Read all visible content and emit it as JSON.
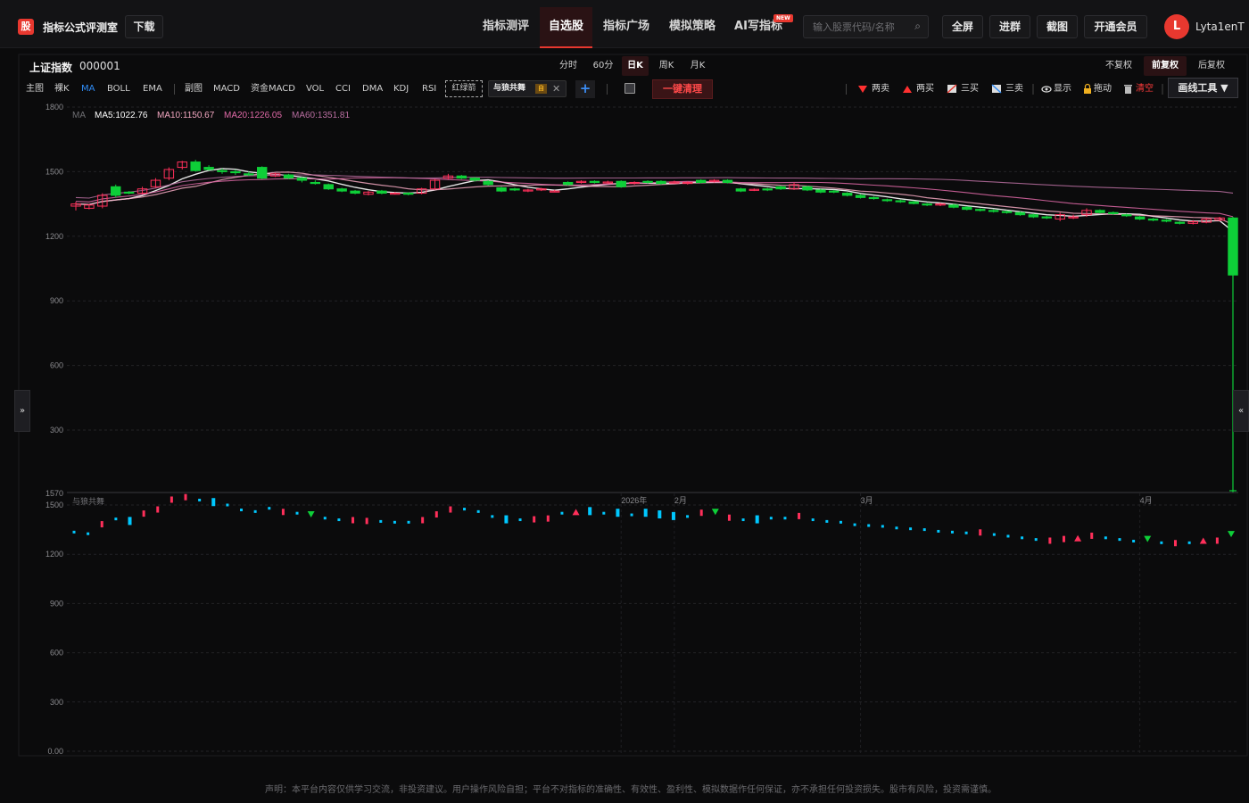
{
  "header": {
    "logo_glyph": "股",
    "app_title": "指标公式评测室",
    "download_label": "下载",
    "nav": [
      {
        "label": "指标测评"
      },
      {
        "label": "自选股"
      },
      {
        "label": "指标广场"
      },
      {
        "label": "模拟策略"
      },
      {
        "label": "AI写指标"
      }
    ],
    "new_badge": "NEW",
    "search_placeholder": "输入股票代码/名称",
    "search_glyph": "⌕",
    "fullscreen_label": "全屏",
    "group_label": "进群",
    "screenshot_label": "截图",
    "vip_label": "开通会员",
    "avatar_letter": "L",
    "username": "Lyta1enT"
  },
  "stock": {
    "name": "上证指数",
    "code": "000001"
  },
  "periods": [
    "分时",
    "60分",
    "日K",
    "周K",
    "月K"
  ],
  "adjust": [
    "不复权",
    "前复权",
    "后复权"
  ],
  "main_indicators": [
    "主图",
    "裸K",
    "MA",
    "BOLL",
    "EMA"
  ],
  "sub_indicators": [
    "副图",
    "MACD",
    "资金MACD",
    "VOL",
    "CCI",
    "DMA",
    "KDJ",
    "RSI"
  ],
  "custom_tag": "红绿箭",
  "chip": {
    "label": "与狼共舞",
    "self": "自",
    "close_glyph": "✕"
  },
  "add_glyph": "+",
  "clear_label": "一键清理",
  "tools": [
    "两卖",
    "两买",
    "三买",
    "三卖",
    "显示",
    "拖动",
    "清空"
  ],
  "draw_tools_label": "画线工具 ▼",
  "side_left": "»",
  "side_right": "«",
  "ma_legend": {
    "label": "MA",
    "ma5": "MA5:1022.76",
    "ma10": "MA10:1150.67",
    "ma20": "MA20:1226.05",
    "ma60": "MA60:1351.81"
  },
  "colors": {
    "up": "#ff2f5a",
    "down": "#0ecf38",
    "ma5": "#ffffff",
    "ma10": "#f2a7c0",
    "ma20": "#e16aa8",
    "ma60": "#b86ea0",
    "accent": "#e8382f",
    "sub_down": "#00c8ff"
  },
  "chart_data": [
    {
      "type": "candlestick",
      "ylim": [
        0,
        1800
      ],
      "yticks": [
        "1800",
        "1500",
        "1200",
        "900",
        "600",
        "300"
      ],
      "lines": [
        "MA5",
        "MA10",
        "MA20",
        "MA60"
      ],
      "grid": true
    },
    {
      "type": "scatter",
      "title": "与狼共舞",
      "ylim": [
        0,
        1570
      ],
      "yticks": [
        "1570",
        "1500",
        "1200",
        "900",
        "600",
        "300",
        "0.00"
      ],
      "xticks": [
        "2026年",
        "2月",
        "3月",
        "4月"
      ],
      "grid": true
    }
  ],
  "candles": [
    [
      1340,
      1350,
      1320,
      1360
    ],
    [
      1330,
      1345,
      1325,
      1350
    ],
    [
      1340,
      1390,
      1330,
      1400
    ],
    [
      1430,
      1390,
      1380,
      1440
    ],
    [
      1405,
      1400,
      1395,
      1410
    ],
    [
      1400,
      1420,
      1395,
      1430
    ],
    [
      1430,
      1460,
      1425,
      1470
    ],
    [
      1470,
      1510,
      1460,
      1520
    ],
    [
      1520,
      1545,
      1510,
      1550
    ],
    [
      1545,
      1505,
      1500,
      1555
    ],
    [
      1520,
      1510,
      1505,
      1530
    ],
    [
      1505,
      1500,
      1490,
      1515
    ],
    [
      1500,
      1495,
      1485,
      1510
    ],
    [
      1490,
      1485,
      1480,
      1500
    ],
    [
      1520,
      1470,
      1465,
      1525
    ],
    [
      1480,
      1490,
      1475,
      1495
    ],
    [
      1485,
      1470,
      1465,
      1490
    ],
    [
      1470,
      1460,
      1450,
      1475
    ],
    [
      1450,
      1445,
      1440,
      1460
    ],
    [
      1440,
      1420,
      1415,
      1445
    ],
    [
      1420,
      1410,
      1405,
      1425
    ],
    [
      1410,
      1400,
      1395,
      1415
    ],
    [
      1395,
      1405,
      1390,
      1410
    ],
    [
      1410,
      1400,
      1395,
      1415
    ],
    [
      1400,
      1400,
      1395,
      1405
    ],
    [
      1400,
      1395,
      1390,
      1405
    ],
    [
      1400,
      1420,
      1395,
      1425
    ],
    [
      1420,
      1460,
      1415,
      1465
    ],
    [
      1470,
      1480,
      1465,
      1490
    ],
    [
      1480,
      1470,
      1465,
      1485
    ],
    [
      1470,
      1460,
      1455,
      1475
    ],
    [
      1455,
      1440,
      1435,
      1460
    ],
    [
      1425,
      1410,
      1405,
      1430
    ],
    [
      1420,
      1415,
      1410,
      1425
    ],
    [
      1410,
      1415,
      1405,
      1420
    ],
    [
      1415,
      1420,
      1410,
      1425
    ],
    [
      1410,
      1410,
      1405,
      1415
    ],
    [
      1450,
      1440,
      1435,
      1455
    ],
    [
      1450,
      1455,
      1445,
      1460
    ],
    [
      1455,
      1450,
      1445,
      1460
    ],
    [
      1450,
      1452,
      1445,
      1458
    ],
    [
      1455,
      1430,
      1425,
      1460
    ],
    [
      1445,
      1450,
      1440,
      1455
    ],
    [
      1455,
      1450,
      1445,
      1460
    ],
    [
      1455,
      1445,
      1440,
      1460
    ],
    [
      1450,
      1452,
      1445,
      1458
    ],
    [
      1445,
      1450,
      1440,
      1455
    ],
    [
      1460,
      1450,
      1445,
      1465
    ],
    [
      1455,
      1460,
      1450,
      1465
    ],
    [
      1460,
      1450,
      1445,
      1465
    ],
    [
      1420,
      1410,
      1405,
      1425
    ],
    [
      1415,
      1418,
      1410,
      1422
    ],
    [
      1420,
      1415,
      1410,
      1425
    ],
    [
      1430,
      1420,
      1415,
      1435
    ],
    [
      1420,
      1440,
      1415,
      1450
    ],
    [
      1430,
      1415,
      1410,
      1435
    ],
    [
      1415,
      1405,
      1400,
      1420
    ],
    [
      1410,
      1405,
      1400,
      1415
    ],
    [
      1400,
      1390,
      1385,
      1405
    ],
    [
      1390,
      1380,
      1375,
      1395
    ],
    [
      1380,
      1375,
      1370,
      1385
    ],
    [
      1370,
      1365,
      1360,
      1375
    ],
    [
      1365,
      1360,
      1355,
      1370
    ],
    [
      1360,
      1352,
      1348,
      1365
    ],
    [
      1350,
      1345,
      1340,
      1355
    ],
    [
      1345,
      1350,
      1340,
      1355
    ],
    [
      1345,
      1335,
      1330,
      1350
    ],
    [
      1335,
      1325,
      1320,
      1340
    ],
    [
      1325,
      1320,
      1315,
      1330
    ],
    [
      1320,
      1315,
      1310,
      1325
    ],
    [
      1315,
      1310,
      1305,
      1320
    ],
    [
      1310,
      1300,
      1295,
      1315
    ],
    [
      1300,
      1290,
      1285,
      1305
    ],
    [
      1290,
      1285,
      1280,
      1295
    ],
    [
      1280,
      1300,
      1270,
      1310
    ],
    [
      1285,
      1290,
      1280,
      1300
    ],
    [
      1300,
      1320,
      1290,
      1330
    ],
    [
      1320,
      1310,
      1305,
      1325
    ],
    [
      1310,
      1305,
      1300,
      1315
    ],
    [
      1300,
      1295,
      1290,
      1305
    ],
    [
      1290,
      1280,
      1275,
      1295
    ],
    [
      1280,
      1275,
      1270,
      1285
    ],
    [
      1275,
      1270,
      1265,
      1280
    ],
    [
      1265,
      1260,
      1255,
      1270
    ],
    [
      1260,
      1268,
      1255,
      1275
    ],
    [
      1265,
      1280,
      1260,
      1285
    ],
    [
      1275,
      1285,
      1270,
      1290
    ],
    [
      1285,
      1020,
      1010,
      1290
    ]
  ],
  "signals": [
    [
      1335,
      "c"
    ],
    [
      1325,
      "c"
    ],
    [
      1380,
      "b"
    ],
    [
      1415,
      "c"
    ],
    [
      1400,
      "w"
    ],
    [
      1445,
      "b"
    ],
    [
      1470,
      "b"
    ],
    [
      1530,
      "b"
    ],
    [
      1545,
      "b"
    ],
    [
      1530,
      "c"
    ],
    [
      1515,
      "w"
    ],
    [
      1500,
      "c"
    ],
    [
      1470,
      "c"
    ],
    [
      1460,
      "c"
    ],
    [
      1480,
      "c"
    ],
    [
      1455,
      "b"
    ],
    [
      1450,
      "c"
    ],
    [
      1440,
      "t"
    ],
    [
      1420,
      "c"
    ],
    [
      1410,
      "c"
    ],
    [
      1405,
      "b"
    ],
    [
      1400,
      "b"
    ],
    [
      1400,
      "c"
    ],
    [
      1395,
      "c"
    ],
    [
      1395,
      "c"
    ],
    [
      1405,
      "b"
    ],
    [
      1440,
      "b"
    ],
    [
      1470,
      "b"
    ],
    [
      1475,
      "c"
    ],
    [
      1460,
      "c"
    ],
    [
      1430,
      "c"
    ],
    [
      1410,
      "w"
    ],
    [
      1410,
      "c"
    ],
    [
      1410,
      "b"
    ],
    [
      1415,
      "b"
    ],
    [
      1450,
      "c"
    ],
    [
      1460,
      "u"
    ],
    [
      1460,
      "w"
    ],
    [
      1450,
      "c"
    ],
    [
      1450,
      "w"
    ],
    [
      1440,
      "c"
    ],
    [
      1450,
      "w"
    ],
    [
      1440,
      "w"
    ],
    [
      1430,
      "w"
    ],
    [
      1430,
      "c"
    ],
    [
      1450,
      "b"
    ],
    [
      1455,
      "t"
    ],
    [
      1420,
      "b"
    ],
    [
      1410,
      "c"
    ],
    [
      1410,
      "w"
    ],
    [
      1420,
      "c"
    ],
    [
      1420,
      "c"
    ],
    [
      1430,
      "b"
    ],
    [
      1410,
      "c"
    ],
    [
      1400,
      "c"
    ],
    [
      1395,
      "c"
    ],
    [
      1380,
      "c"
    ],
    [
      1375,
      "c"
    ],
    [
      1370,
      "c"
    ],
    [
      1360,
      "c"
    ],
    [
      1355,
      "c"
    ],
    [
      1350,
      "c"
    ],
    [
      1340,
      "c"
    ],
    [
      1335,
      "c"
    ],
    [
      1330,
      "c"
    ],
    [
      1330,
      "b"
    ],
    [
      1320,
      "c"
    ],
    [
      1310,
      "c"
    ],
    [
      1300,
      "c"
    ],
    [
      1290,
      "c"
    ],
    [
      1280,
      "b"
    ],
    [
      1290,
      "b"
    ],
    [
      1300,
      "u"
    ],
    [
      1310,
      "b"
    ],
    [
      1300,
      "c"
    ],
    [
      1290,
      "c"
    ],
    [
      1280,
      "c"
    ],
    [
      1290,
      "t"
    ],
    [
      1270,
      "c"
    ],
    [
      1265,
      "b"
    ],
    [
      1270,
      "c"
    ],
    [
      1285,
      "u"
    ],
    [
      1280,
      "b"
    ],
    [
      1320,
      "t"
    ]
  ],
  "disclaimer": "声明：本平台内容仅供学习交流，非投资建议。用户操作风险自担；平台不对指标的准确性、有效性、盈利性、模拟数据作任何保证，亦不承担任何投资损失。股市有风险，投资需谨慎。"
}
